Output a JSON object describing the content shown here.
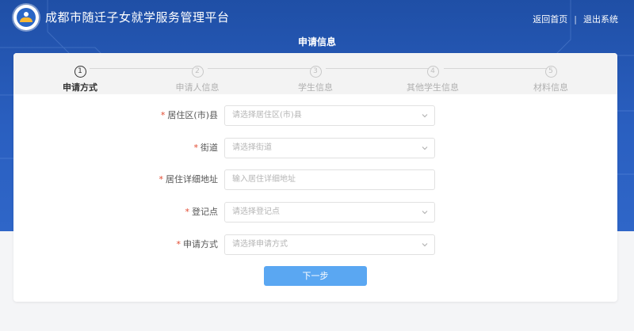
{
  "header": {
    "site_title": "成都市随迁子女就学服务管理平台",
    "link_home": "返回首页",
    "separator": "|",
    "link_logout": "退出系统",
    "page_heading": "申请信息"
  },
  "steps": [
    {
      "num": "1",
      "label": "申请方式",
      "active": true
    },
    {
      "num": "2",
      "label": "申请人信息",
      "active": false
    },
    {
      "num": "3",
      "label": "学生信息",
      "active": false
    },
    {
      "num": "4",
      "label": "其他学生信息",
      "active": false
    },
    {
      "num": "5",
      "label": "材料信息",
      "active": false
    }
  ],
  "form": {
    "required_mark": "*",
    "fields": [
      {
        "label": "居住区(市)县",
        "placeholder": "请选择居住区(市)县",
        "type": "select"
      },
      {
        "label": "街道",
        "placeholder": "请选择街道",
        "type": "select"
      },
      {
        "label": "居住详细地址",
        "placeholder": "输入居住详细地址",
        "type": "input"
      },
      {
        "label": "登记点",
        "placeholder": "请选择登记点",
        "type": "select"
      },
      {
        "label": "申请方式",
        "placeholder": "请选择申请方式",
        "type": "select"
      }
    ],
    "next_label": "下一步"
  },
  "colors": {
    "header_blue": "#2a5fc0",
    "button_blue": "#5aa7f2",
    "required_red": "#e2492f"
  }
}
